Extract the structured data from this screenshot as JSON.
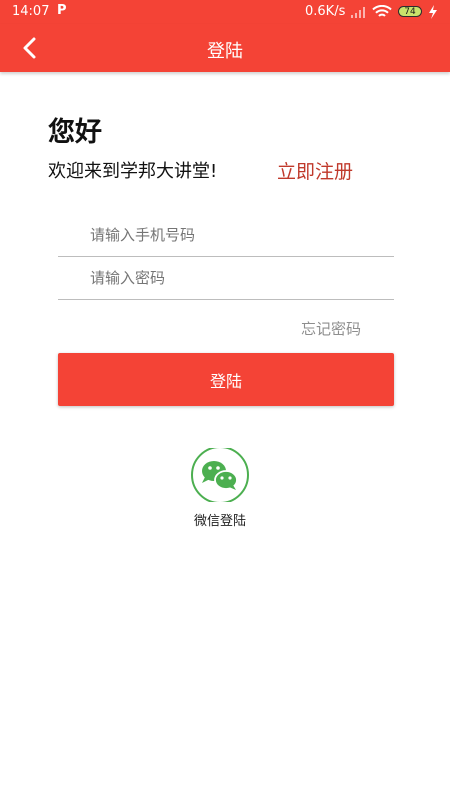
{
  "status_bar": {
    "time": "14:07",
    "app_icon": "P",
    "net_speed": "0.6K/s",
    "battery": "74"
  },
  "app_bar": {
    "title": "登陆",
    "back_icon": "chevron-left-icon"
  },
  "greeting": {
    "hello": "您好",
    "welcome": "欢迎来到学邦大讲堂!",
    "register": "立即注册"
  },
  "form": {
    "phone_placeholder": "请输入手机号码",
    "password_placeholder": "请输入密码",
    "forgot_password": "忘记密码",
    "login_button": "登陆"
  },
  "social": {
    "wechat_label": "微信登陆",
    "wechat_icon": "wechat-icon"
  },
  "colors": {
    "brand_red": "#f44336",
    "register_red": "#c0392b",
    "wechat_green": "#4caf50"
  }
}
